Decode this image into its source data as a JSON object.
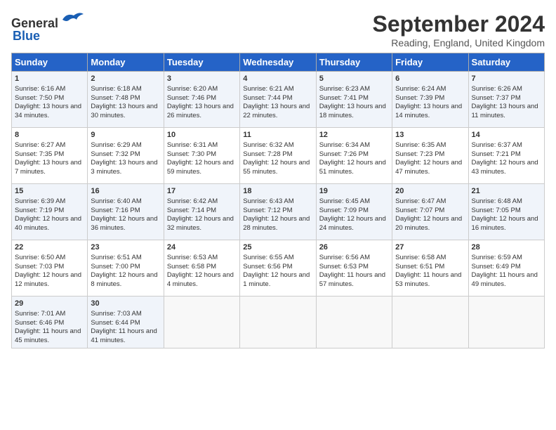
{
  "header": {
    "logo_general": "General",
    "logo_blue": "Blue",
    "month": "September 2024",
    "location": "Reading, England, United Kingdom"
  },
  "days_of_week": [
    "Sunday",
    "Monday",
    "Tuesday",
    "Wednesday",
    "Thursday",
    "Friday",
    "Saturday"
  ],
  "weeks": [
    [
      {
        "day": "1",
        "sunrise": "6:16 AM",
        "sunset": "7:50 PM",
        "daylight": "13 hours and 34 minutes."
      },
      {
        "day": "2",
        "sunrise": "6:18 AM",
        "sunset": "7:48 PM",
        "daylight": "13 hours and 30 minutes."
      },
      {
        "day": "3",
        "sunrise": "6:20 AM",
        "sunset": "7:46 PM",
        "daylight": "13 hours and 26 minutes."
      },
      {
        "day": "4",
        "sunrise": "6:21 AM",
        "sunset": "7:44 PM",
        "daylight": "13 hours and 22 minutes."
      },
      {
        "day": "5",
        "sunrise": "6:23 AM",
        "sunset": "7:41 PM",
        "daylight": "13 hours and 18 minutes."
      },
      {
        "day": "6",
        "sunrise": "6:24 AM",
        "sunset": "7:39 PM",
        "daylight": "13 hours and 14 minutes."
      },
      {
        "day": "7",
        "sunrise": "6:26 AM",
        "sunset": "7:37 PM",
        "daylight": "13 hours and 11 minutes."
      }
    ],
    [
      {
        "day": "8",
        "sunrise": "6:27 AM",
        "sunset": "7:35 PM",
        "daylight": "13 hours and 7 minutes."
      },
      {
        "day": "9",
        "sunrise": "6:29 AM",
        "sunset": "7:32 PM",
        "daylight": "13 hours and 3 minutes."
      },
      {
        "day": "10",
        "sunrise": "6:31 AM",
        "sunset": "7:30 PM",
        "daylight": "12 hours and 59 minutes."
      },
      {
        "day": "11",
        "sunrise": "6:32 AM",
        "sunset": "7:28 PM",
        "daylight": "12 hours and 55 minutes."
      },
      {
        "day": "12",
        "sunrise": "6:34 AM",
        "sunset": "7:26 PM",
        "daylight": "12 hours and 51 minutes."
      },
      {
        "day": "13",
        "sunrise": "6:35 AM",
        "sunset": "7:23 PM",
        "daylight": "12 hours and 47 minutes."
      },
      {
        "day": "14",
        "sunrise": "6:37 AM",
        "sunset": "7:21 PM",
        "daylight": "12 hours and 43 minutes."
      }
    ],
    [
      {
        "day": "15",
        "sunrise": "6:39 AM",
        "sunset": "7:19 PM",
        "daylight": "12 hours and 40 minutes."
      },
      {
        "day": "16",
        "sunrise": "6:40 AM",
        "sunset": "7:16 PM",
        "daylight": "12 hours and 36 minutes."
      },
      {
        "day": "17",
        "sunrise": "6:42 AM",
        "sunset": "7:14 PM",
        "daylight": "12 hours and 32 minutes."
      },
      {
        "day": "18",
        "sunrise": "6:43 AM",
        "sunset": "7:12 PM",
        "daylight": "12 hours and 28 minutes."
      },
      {
        "day": "19",
        "sunrise": "6:45 AM",
        "sunset": "7:09 PM",
        "daylight": "12 hours and 24 minutes."
      },
      {
        "day": "20",
        "sunrise": "6:47 AM",
        "sunset": "7:07 PM",
        "daylight": "12 hours and 20 minutes."
      },
      {
        "day": "21",
        "sunrise": "6:48 AM",
        "sunset": "7:05 PM",
        "daylight": "12 hours and 16 minutes."
      }
    ],
    [
      {
        "day": "22",
        "sunrise": "6:50 AM",
        "sunset": "7:03 PM",
        "daylight": "12 hours and 12 minutes."
      },
      {
        "day": "23",
        "sunrise": "6:51 AM",
        "sunset": "7:00 PM",
        "daylight": "12 hours and 8 minutes."
      },
      {
        "day": "24",
        "sunrise": "6:53 AM",
        "sunset": "6:58 PM",
        "daylight": "12 hours and 4 minutes."
      },
      {
        "day": "25",
        "sunrise": "6:55 AM",
        "sunset": "6:56 PM",
        "daylight": "12 hours and 1 minute."
      },
      {
        "day": "26",
        "sunrise": "6:56 AM",
        "sunset": "6:53 PM",
        "daylight": "11 hours and 57 minutes."
      },
      {
        "day": "27",
        "sunrise": "6:58 AM",
        "sunset": "6:51 PM",
        "daylight": "11 hours and 53 minutes."
      },
      {
        "day": "28",
        "sunrise": "6:59 AM",
        "sunset": "6:49 PM",
        "daylight": "11 hours and 49 minutes."
      }
    ],
    [
      {
        "day": "29",
        "sunrise": "7:01 AM",
        "sunset": "6:46 PM",
        "daylight": "11 hours and 45 minutes."
      },
      {
        "day": "30",
        "sunrise": "7:03 AM",
        "sunset": "6:44 PM",
        "daylight": "11 hours and 41 minutes."
      },
      null,
      null,
      null,
      null,
      null
    ]
  ]
}
